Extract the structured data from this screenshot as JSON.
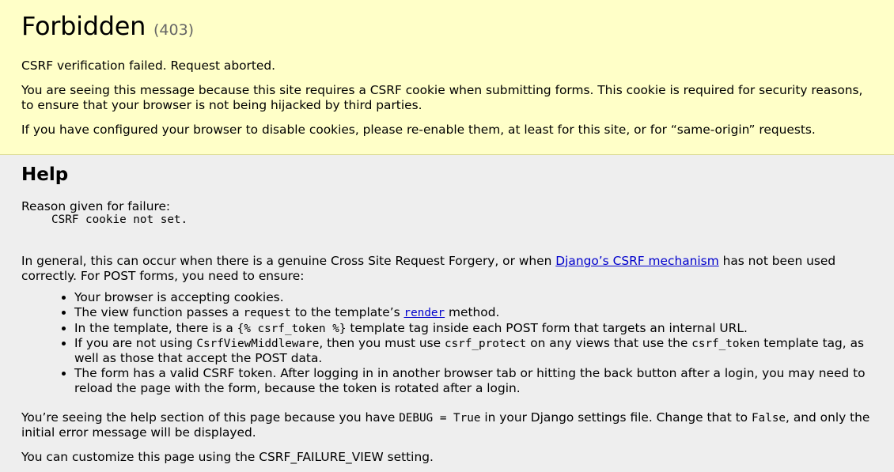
{
  "summary": {
    "title": "Forbidden",
    "code": "(403)",
    "p1": "CSRF verification failed. Request aborted.",
    "p2": "You are seeing this message because this site requires a CSRF cookie when submitting forms. This cookie is required for security reasons, to ensure that your browser is not being hijacked by third parties.",
    "p3": "If you have configured your browser to disable cookies, please re-enable them, at least for this site, or for “same-origin” requests."
  },
  "help": {
    "heading": "Help",
    "reason_label": "Reason given for failure:",
    "reason_value": "CSRF cookie not set.",
    "general_before": "In general, this can occur when there is a genuine Cross Site Request Forgery, or when ",
    "general_link": "Django’s CSRF mechanism",
    "general_after": " has not been used correctly. For POST forms, you need to ensure:",
    "items": {
      "i1": "Your browser is accepting cookies.",
      "i2_a": "The view function passes a ",
      "i2_code": "request",
      "i2_b": " to the template’s ",
      "i2_link": "render",
      "i2_c": " method.",
      "i3_a": "In the template, there is a ",
      "i3_code": "{% csrf_token %}",
      "i3_b": " template tag inside each POST form that targets an internal URL.",
      "i4_a": "If you are not using ",
      "i4_code1": "CsrfViewMiddleware",
      "i4_b": ", then you must use ",
      "i4_code2": "csrf_protect",
      "i4_c": " on any views that use the ",
      "i4_code3": "csrf_token",
      "i4_d": " template tag, as well as those that accept the POST data.",
      "i5": "The form has a valid CSRF token. After logging in in another browser tab or hitting the back button after a login, you may need to reload the page with the form, because the token is rotated after a login."
    },
    "debug_a": "You’re seeing the help section of this page because you have ",
    "debug_code1": "DEBUG = True",
    "debug_b": " in your Django settings file. Change that to ",
    "debug_code2": "False",
    "debug_c": ", and only the initial error message will be displayed.",
    "customize": "You can customize this page using the CSRF_FAILURE_VIEW setting."
  }
}
